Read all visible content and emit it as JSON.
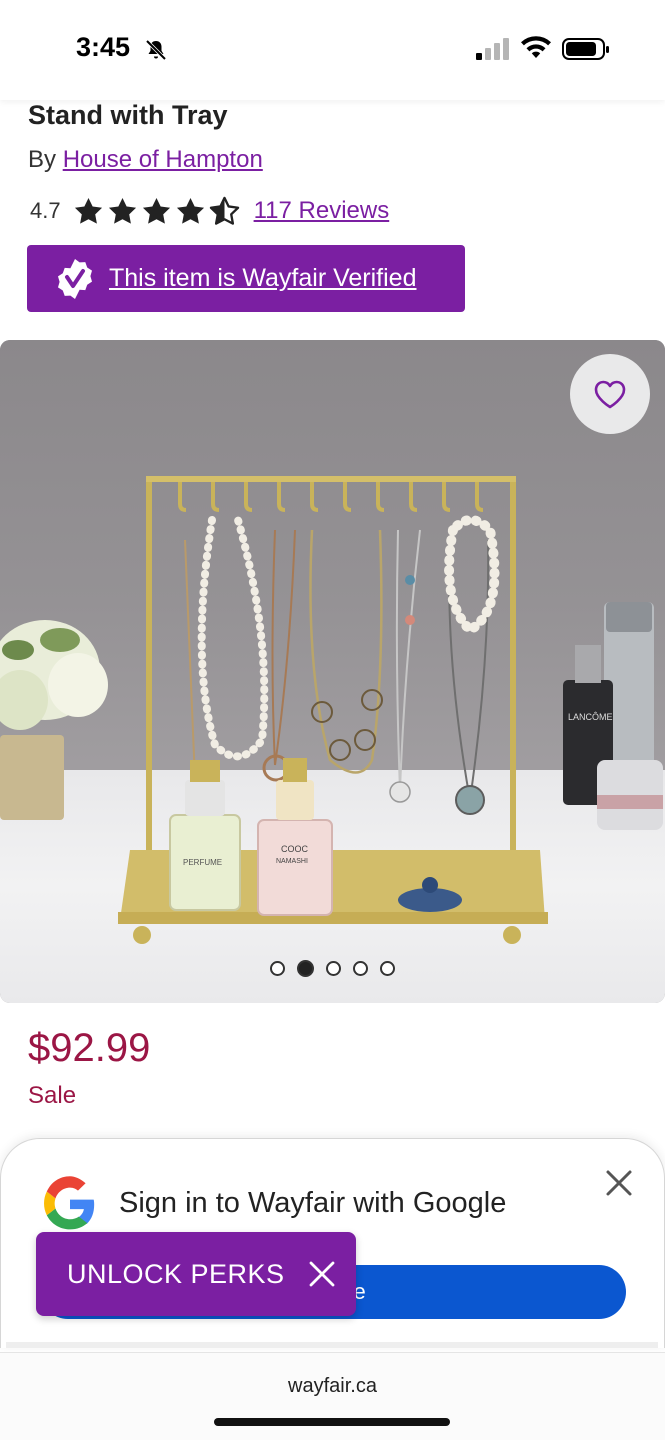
{
  "status_bar": {
    "time": "3:45"
  },
  "product": {
    "title": "Stand with Tray",
    "by_prefix": "By ",
    "brand": "House of Hampton",
    "rating": "4.7",
    "rating_stars": 4.5,
    "reviews": "117 Reviews",
    "verified": "This item is Wayfair Verified"
  },
  "image": {
    "carousel": {
      "count": 5,
      "active": 2
    },
    "perfume_labels": [
      "PERFUME",
      "COOC",
      "NAMASHI",
      "LANCÔME"
    ]
  },
  "pricing": {
    "price": "$92.99",
    "sale_label": "Sale"
  },
  "google_prompt": {
    "text": "Sign in to Wayfair with Google",
    "button_partial": "ue"
  },
  "promo": {
    "label": "UNLOCK PERKS"
  },
  "browser": {
    "url": "wayfair.ca"
  },
  "colors": {
    "brand_purple": "#7b1fa2",
    "price_red": "#9b1645",
    "google_blue": "#0b57d0"
  }
}
